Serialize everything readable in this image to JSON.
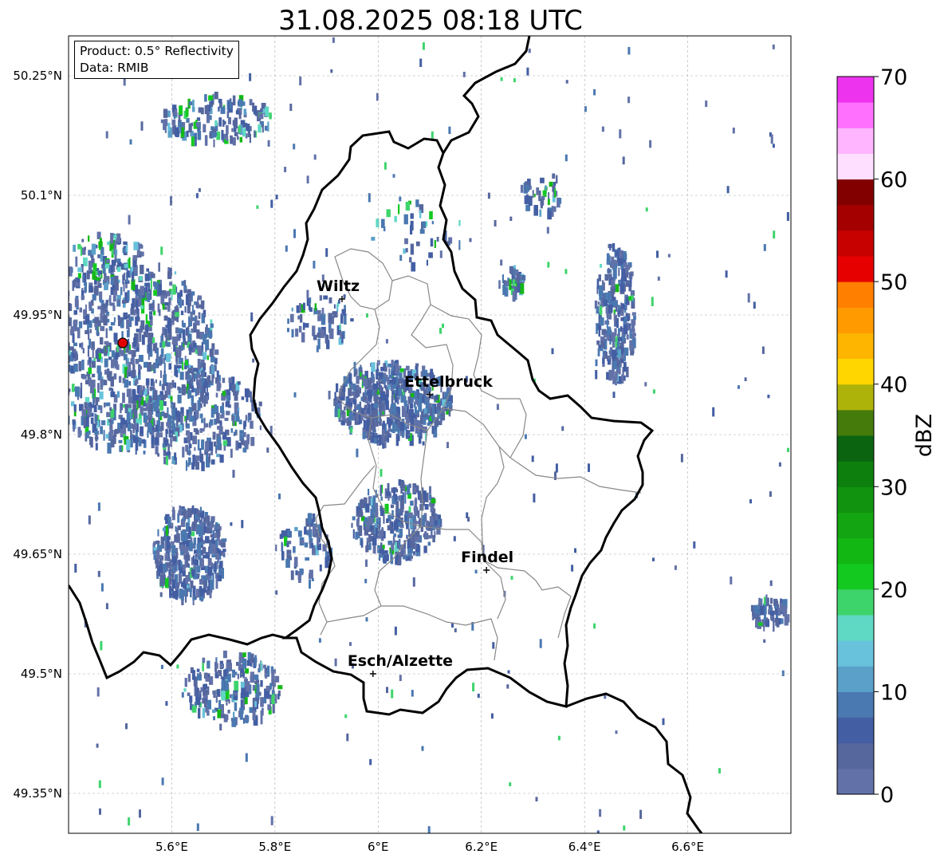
{
  "title": "31.08.2025 08:18 UTC",
  "info": {
    "product": "Product: 0.5° Reflectivity",
    "source": "Data: RMIB"
  },
  "axes": {
    "lat_ticks": [
      "50.25°N",
      "50.1°N",
      "49.95°N",
      "49.8°N",
      "49.65°N",
      "49.5°N",
      "49.35°N"
    ],
    "lon_ticks": [
      "5.6°E",
      "5.8°E",
      "6°E",
      "6.2°E",
      "6.4°E",
      "6.6°E"
    ]
  },
  "cities": [
    {
      "name": "Wiltz",
      "lon": 5.93,
      "lat": 49.97
    },
    {
      "name": "Ettelbruck",
      "lon": 6.1,
      "lat": 49.85
    },
    {
      "name": "Findel",
      "lon": 6.21,
      "lat": 49.63
    },
    {
      "name": "Esch/Alzette",
      "lon": 5.99,
      "lat": 49.5
    }
  ],
  "radar_site": {
    "lon": 5.505,
    "lat": 49.915,
    "color": "#e00000"
  },
  "colorbar": {
    "label": "dBZ",
    "ticks": [
      "0",
      "10",
      "20",
      "30",
      "40",
      "50",
      "60",
      "70"
    ],
    "min": 0,
    "max": 70,
    "step": 2.5,
    "colors": [
      "#6272a8",
      "#56679e",
      "#435ea3",
      "#4a78b0",
      "#5ba0c8",
      "#68c2dc",
      "#5fd8c4",
      "#3ed46c",
      "#13c920",
      "#13b714",
      "#13a512",
      "#11930f",
      "#0d7f0d",
      "#0b6410",
      "#457b0b",
      "#aeb30a",
      "#ffd600",
      "#fdb500",
      "#ff9a00",
      "#ff7f00",
      "#e70000",
      "#c70000",
      "#a50000",
      "#820000",
      "#ffdfff",
      "#ffb5ff",
      "#ff70ff",
      "#ee33ee"
    ]
  }
}
